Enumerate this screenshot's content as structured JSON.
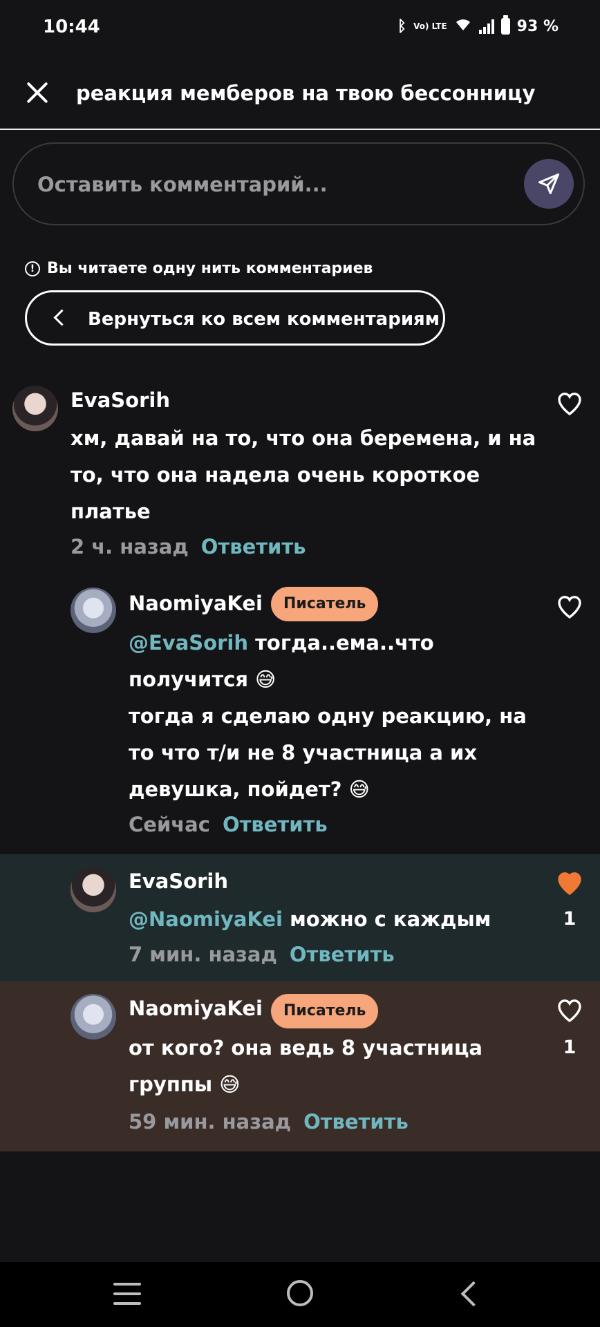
{
  "status_bar": {
    "time": "10:44",
    "lte_label": "Vo) LTE",
    "battery": "93 %"
  },
  "header": {
    "title": "реакция мемберов на твою бессонницу",
    "close_icon": "close-icon"
  },
  "comment_input": {
    "placeholder": "Оставить комментарий...",
    "send_icon": "send-icon"
  },
  "thread_notice": {
    "text": "Вы читаете одну нить комментариев",
    "icon": "info-icon"
  },
  "back_button": {
    "label": "Вернуться ко всем комментариям",
    "icon": "chevron-left-icon"
  },
  "comments": [
    {
      "username": "EvaSorih",
      "badge": "",
      "mention": "",
      "lines": [
        "хм, давай на то, что она беремена, и на",
        "то, что она надела очень короткое",
        "платье"
      ],
      "time": "2 ч. назад",
      "reply": "Ответить",
      "liked": false,
      "likes": ""
    },
    {
      "username": "NaomiyaKei",
      "badge": "Писатель",
      "mention": "@EvaSorih",
      "lines": [
        "тогда..ема..что",
        "получится 😅",
        "тогда я сделаю одну реакцию, на",
        "то что т/и не 8 участница а их",
        "девушка, пойдет? 😅"
      ],
      "time": "Сейчас",
      "reply": "Ответить",
      "liked": false,
      "likes": ""
    },
    {
      "username": "EvaSorih",
      "badge": "",
      "mention": "@NaomiyaKei",
      "lines": [
        "можно с каждым"
      ],
      "time": "7 мин. назад",
      "reply": "Ответить",
      "liked": true,
      "likes": "1"
    },
    {
      "username": "NaomiyaKei",
      "badge": "Писатель",
      "mention": "",
      "lines": [
        "от кого? она ведь 8 участница",
        "группы 😅"
      ],
      "time": "59 мин. назад",
      "reply": "Ответить",
      "liked": false,
      "likes": "1"
    }
  ],
  "colors": {
    "background": "#141416",
    "accent_mention": "#71b7c0",
    "badge": "#f7a57a",
    "liked_heart": "#f07a35",
    "highlight_row_1": "#1f2a2c",
    "highlight_row_2": "#3a2d28"
  }
}
